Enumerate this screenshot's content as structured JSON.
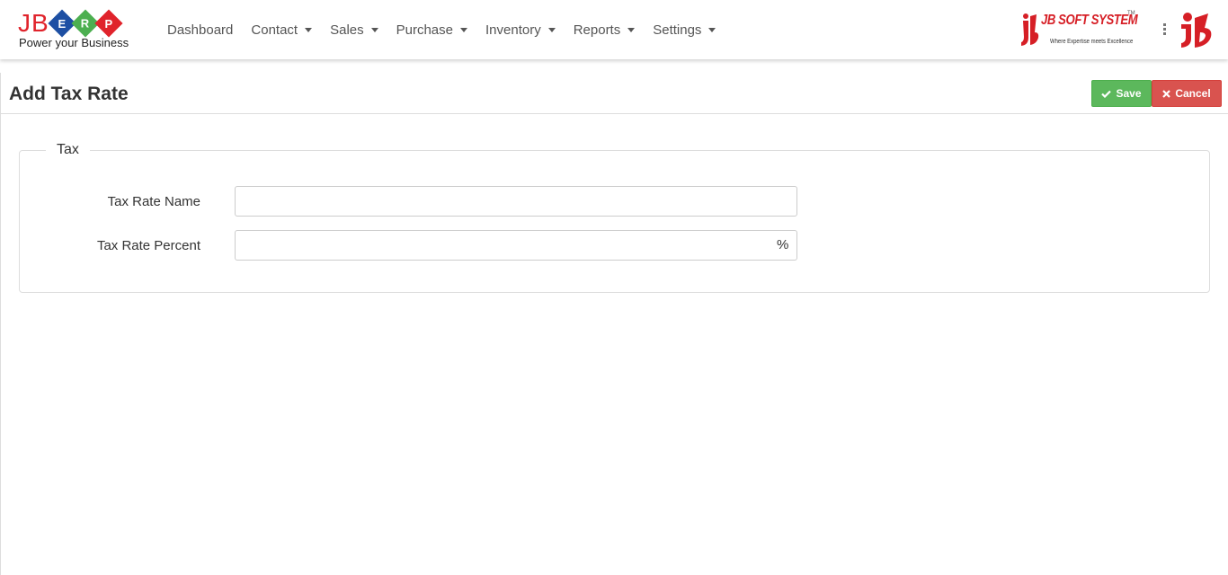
{
  "brand": {
    "logo_letters": [
      "JB",
      "E",
      "R",
      "P"
    ],
    "tagline": "Power your Business",
    "company_name": "JB SOFT SYSTEM",
    "company_tm": "TM",
    "company_tagline": "Where Expertise meets Excellence",
    "colors": {
      "red": "#e0232b",
      "blue": "#1d4fa3",
      "green": "#4caf50"
    }
  },
  "nav": {
    "items": [
      {
        "label": "Dashboard",
        "dropdown": false
      },
      {
        "label": "Contact",
        "dropdown": true
      },
      {
        "label": "Sales",
        "dropdown": true
      },
      {
        "label": "Purchase",
        "dropdown": true
      },
      {
        "label": "Inventory",
        "dropdown": true
      },
      {
        "label": "Reports",
        "dropdown": true
      },
      {
        "label": "Settings",
        "dropdown": true
      }
    ]
  },
  "header": {
    "title": "Add Tax Rate",
    "save_label": "Save",
    "save_icon": "check-icon",
    "cancel_label": "Cancel",
    "cancel_icon": "times-icon",
    "save_color": "#5cb85c",
    "cancel_color": "#d9534f"
  },
  "form": {
    "legend": "Tax",
    "tax_rate_name": {
      "label": "Tax Rate Name",
      "value": "",
      "placeholder": ""
    },
    "tax_rate_percent": {
      "label": "Tax Rate Percent",
      "value": "",
      "placeholder": "",
      "addon": "%"
    }
  }
}
